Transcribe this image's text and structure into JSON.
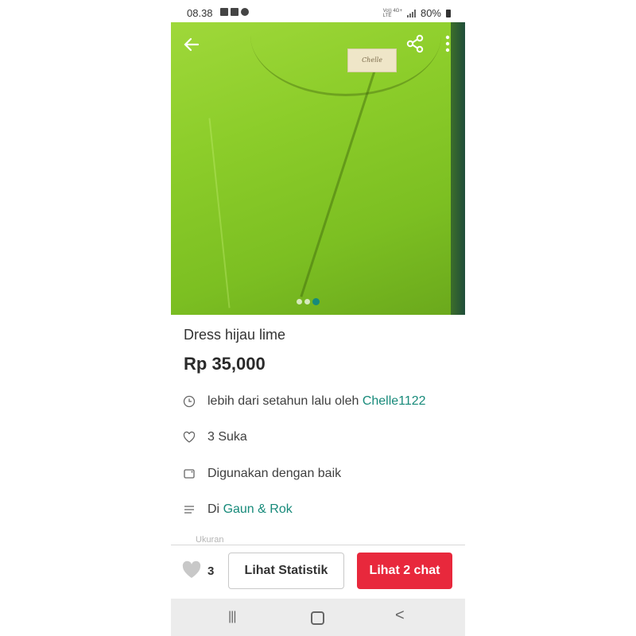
{
  "status_bar": {
    "time": "08.38",
    "network_top": "Vo)) 4G+",
    "network_bottom": "LTE",
    "battery": "80%"
  },
  "listing": {
    "title": "Dress hijau lime",
    "price": "Rp 35,000",
    "image_label": "Chelle",
    "image_count": 3,
    "active_image_index": 2
  },
  "details": {
    "posted_text": "lebih dari setahun lalu oleh ",
    "seller": "Chelle1122",
    "likes_text": "3 Suka",
    "condition": "Digunakan dengan baik",
    "category_prefix": "Di ",
    "category": "Gaun & Rok",
    "size_label": "Ukuran"
  },
  "actions": {
    "like_count": "3",
    "stats_label": "Lihat Statistik",
    "chat_label": "Lihat 2 chat"
  },
  "nav": {
    "recent": "|||",
    "back": "<"
  },
  "colors": {
    "accent": "#178a7a",
    "chat_button": "#e8283c",
    "dress_green": "#8ccd2a"
  }
}
